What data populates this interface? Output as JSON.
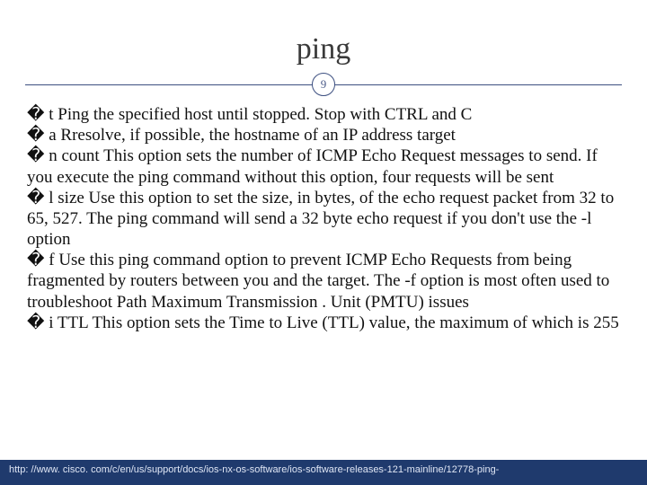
{
  "title": "ping",
  "page_number": "9",
  "bullets": [
    {
      "flag": "� t ",
      "text": "Ping the specified host until stopped. Stop with CTRL and C"
    },
    {
      "flag": "� a ",
      "text": "Rresolve, if possible, the hostname of an IP address target"
    },
    {
      "flag": "� n ",
      "text": "count This option sets the number of ICMP Echo Request messages to send. If you execute the ping command without this option, four requests will be sent"
    },
    {
      "flag": "� l ",
      "text": "size Use this option to set the size, in bytes, of the echo request packet from 32 to 65, 527. The ping command will send a 32 byte echo request if you don't use the -l option"
    },
    {
      "flag": "� f ",
      "text": "Use this ping command option to prevent ICMP Echo Requests from being fragmented by routers between you and the target. The -f option is most often used to troubleshoot Path Maximum Transmission . Unit (PMTU) issues"
    },
    {
      "flag": "� i ",
      "text": "TTL This option sets the Time to Live (TTL) value, the maximum of which is 255"
    }
  ],
  "footer_text": "http: //www. cisco. com/c/en/us/support/docs/ios-nx-os-software/ios-software-releases-121-mainline/12778-ping-"
}
